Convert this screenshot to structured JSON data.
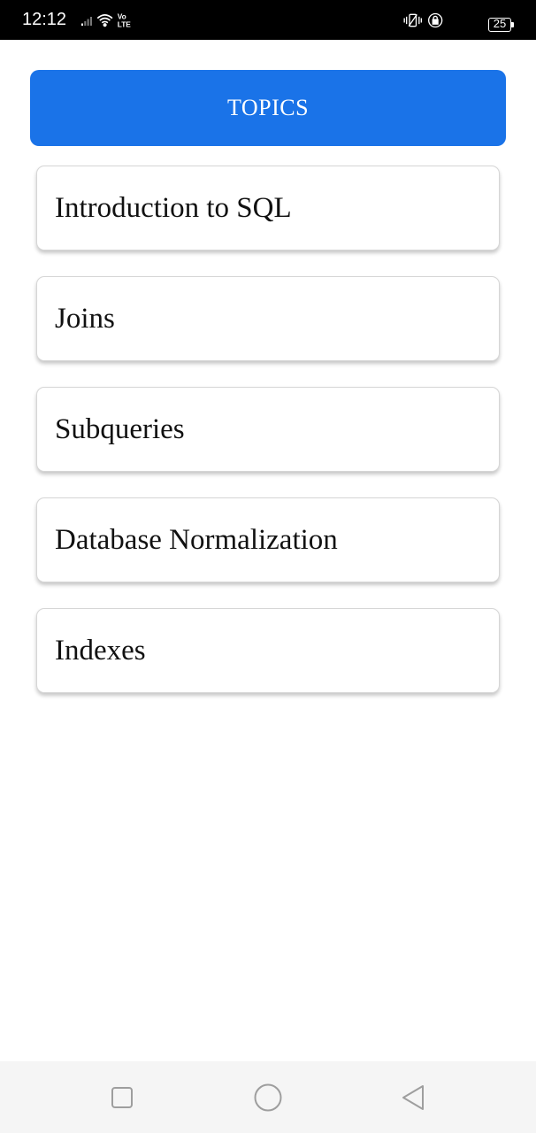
{
  "status_bar": {
    "time": "12:12",
    "network_label": "Vo LTE",
    "battery_level": "25",
    "icons": [
      "signal-icon",
      "wifi-icon",
      "volte-icon",
      "vibrate-icon",
      "rotation-lock-icon",
      "battery-icon"
    ]
  },
  "header": {
    "title": "TOPICS",
    "color": "#1a73e8"
  },
  "topics": [
    {
      "label": "Introduction to SQL"
    },
    {
      "label": "Joins"
    },
    {
      "label": "Subqueries"
    },
    {
      "label": "Database Normalization"
    },
    {
      "label": "Indexes"
    }
  ],
  "nav_bar": {
    "buttons": [
      "recents-square-icon",
      "home-circle-icon",
      "back-triangle-icon"
    ]
  }
}
